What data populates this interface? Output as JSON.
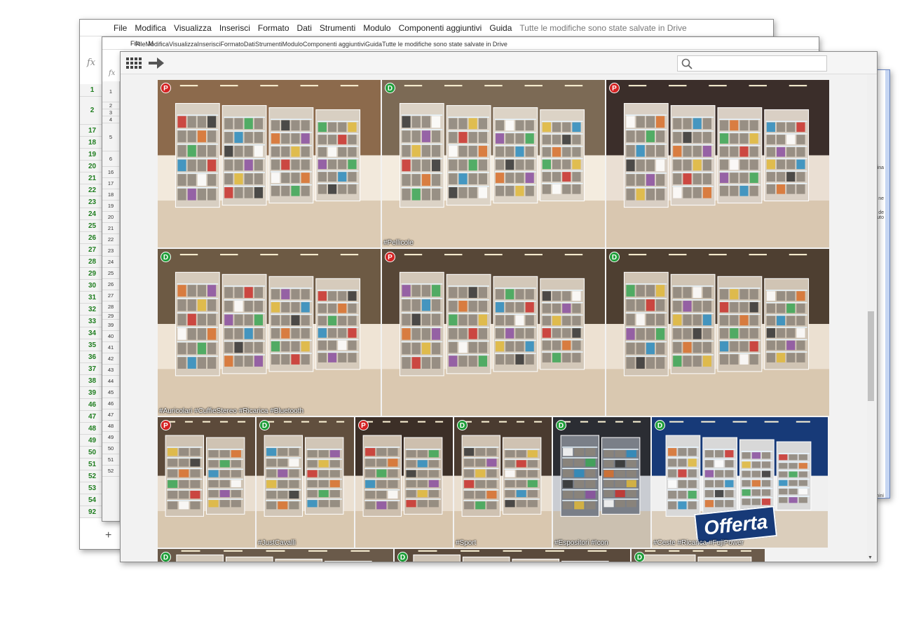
{
  "sheet_back": {
    "menu": [
      "File",
      "Modifica",
      "Visualizza",
      "Inserisci",
      "Formato",
      "Dati",
      "Strumenti",
      "Modulo",
      "Componenti aggiuntivi",
      "Guida"
    ],
    "saved": "Tutte le modifiche sono state salvate in Drive",
    "fx": "fx",
    "rows": [
      "1",
      "2",
      "17",
      "18",
      "19",
      "20",
      "21",
      "22",
      "23",
      "24",
      "25",
      "26",
      "27",
      "28",
      "29",
      "30",
      "31",
      "32",
      "33",
      "34",
      "35",
      "36",
      "37",
      "38",
      "39",
      "46",
      "47",
      "48",
      "49",
      "50",
      "51",
      "52",
      "53",
      "54",
      "92"
    ],
    "add_sheet": "+"
  },
  "sheet_mid": {
    "menu": [
      "File",
      "M"
    ],
    "fx": "fx",
    "rows": [
      "1",
      "2",
      "3",
      "4",
      "5",
      "6",
      "16",
      "17",
      "18",
      "19",
      "20",
      "21",
      "22",
      "23",
      "24",
      "25",
      "26",
      "27",
      "28",
      "29",
      "39",
      "40",
      "41",
      "42",
      "43",
      "44",
      "45",
      "46",
      "47",
      "48",
      "49",
      "50",
      "51",
      "52"
    ]
  },
  "sheet_front_menu": {
    "menu": [
      "File",
      "Modifica",
      "Visualizza",
      "Inserisci",
      "Formato",
      "Dati",
      "Strumenti",
      "Modulo",
      "Componenti aggiuntivi",
      "Guida"
    ],
    "saved": "Tutte le modifiche sono state salvate in Drive"
  },
  "side_panel": {
    "snippets": [
      "rina",
      "ne",
      "a de\nzzuto",
      "mini"
    ]
  },
  "viewer": {
    "search": {
      "placeholder": "",
      "value": ""
    },
    "colors": {
      "P": "#d42222",
      "D": "#1f9e3a"
    },
    "tiles": [
      {
        "badge": "P",
        "tags": ""
      },
      {
        "badge": "D",
        "tags": "#Pellicole"
      },
      {
        "badge": "P",
        "tags": ""
      },
      {
        "badge": "D",
        "tags": "#Auricolari #CuffieStereo #Ricarica #Bluetooth"
      },
      {
        "badge": "P",
        "tags": ""
      },
      {
        "badge": "D",
        "tags": ""
      },
      {
        "badge": "P",
        "tags": ""
      },
      {
        "badge": "D",
        "tags": "#JustCavalli"
      },
      {
        "badge": "P",
        "tags": ""
      },
      {
        "badge": "D",
        "tags": "#Sport"
      },
      {
        "badge": "D",
        "tags": "#Espositori #Icon"
      },
      {
        "badge": "D",
        "tags": "#Ceste #Ricarica #FujiPower",
        "sign": "Offerta"
      },
      {
        "badge": "D",
        "tags": ""
      },
      {
        "badge": "D",
        "tags": ""
      },
      {
        "badge": "D",
        "tags": ""
      }
    ]
  }
}
